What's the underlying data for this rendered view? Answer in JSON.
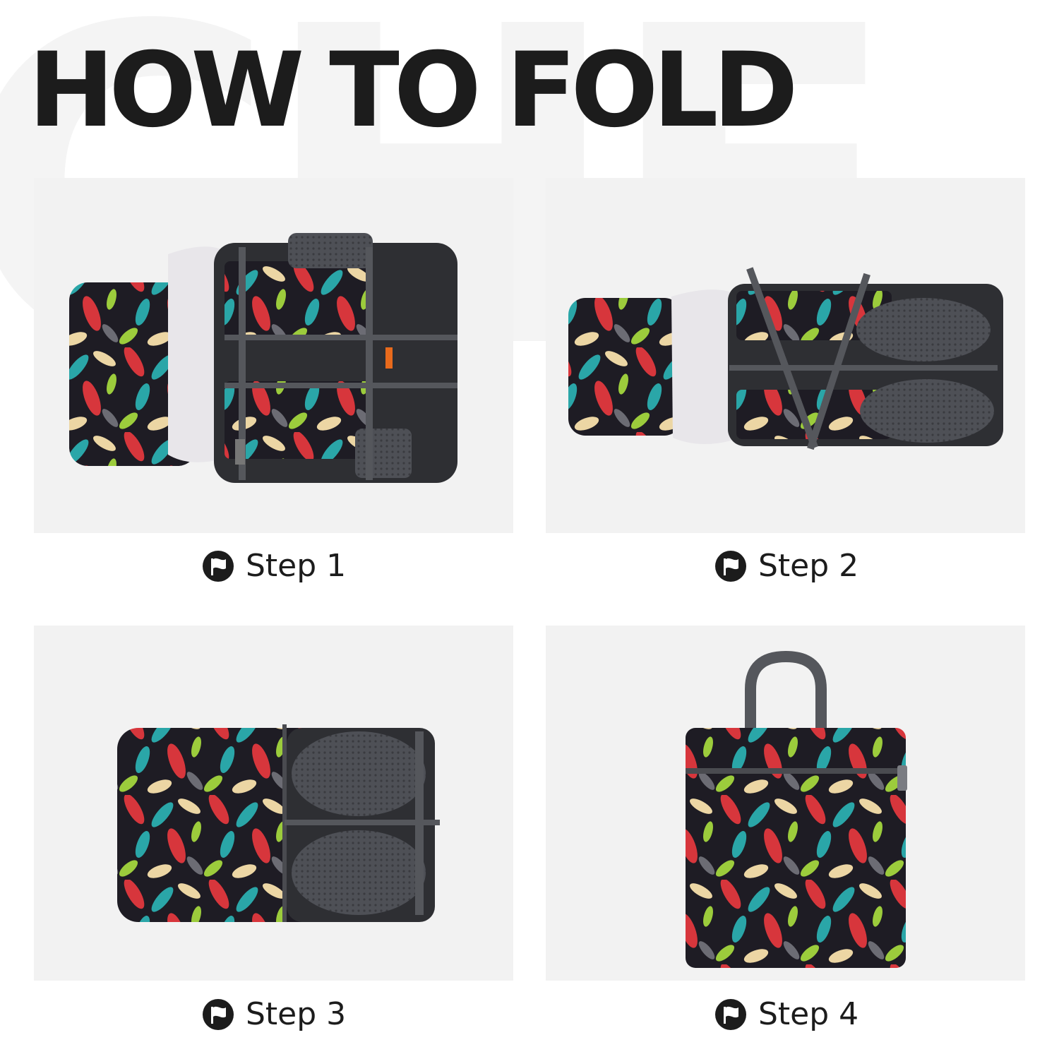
{
  "page": {
    "title": "HOW TO FOLD",
    "watermark_text": "CHF",
    "colors": {
      "title": "#1c1c1c",
      "panel_bg": "#f2f2f2",
      "bag_dark": "#2b2b2e",
      "strap_grey": "#55575c",
      "leaf_red": "#d7363c",
      "leaf_teal": "#2aa6a8",
      "leaf_cream": "#ecd6a4",
      "leaf_green": "#9ccc3c"
    }
  },
  "steps": [
    {
      "label": "Step 1",
      "icon": "flag-circle-icon",
      "image": "backpack-unfolded-back-view"
    },
    {
      "label": "Step 2",
      "icon": "flag-circle-icon",
      "image": "backpack-straps-folded-in"
    },
    {
      "label": "Step 3",
      "icon": "flag-circle-icon",
      "image": "backpack-folded-in-half"
    },
    {
      "label": "Step 4",
      "icon": "flag-circle-icon",
      "image": "backpack-packed-pouch-with-handle"
    }
  ]
}
